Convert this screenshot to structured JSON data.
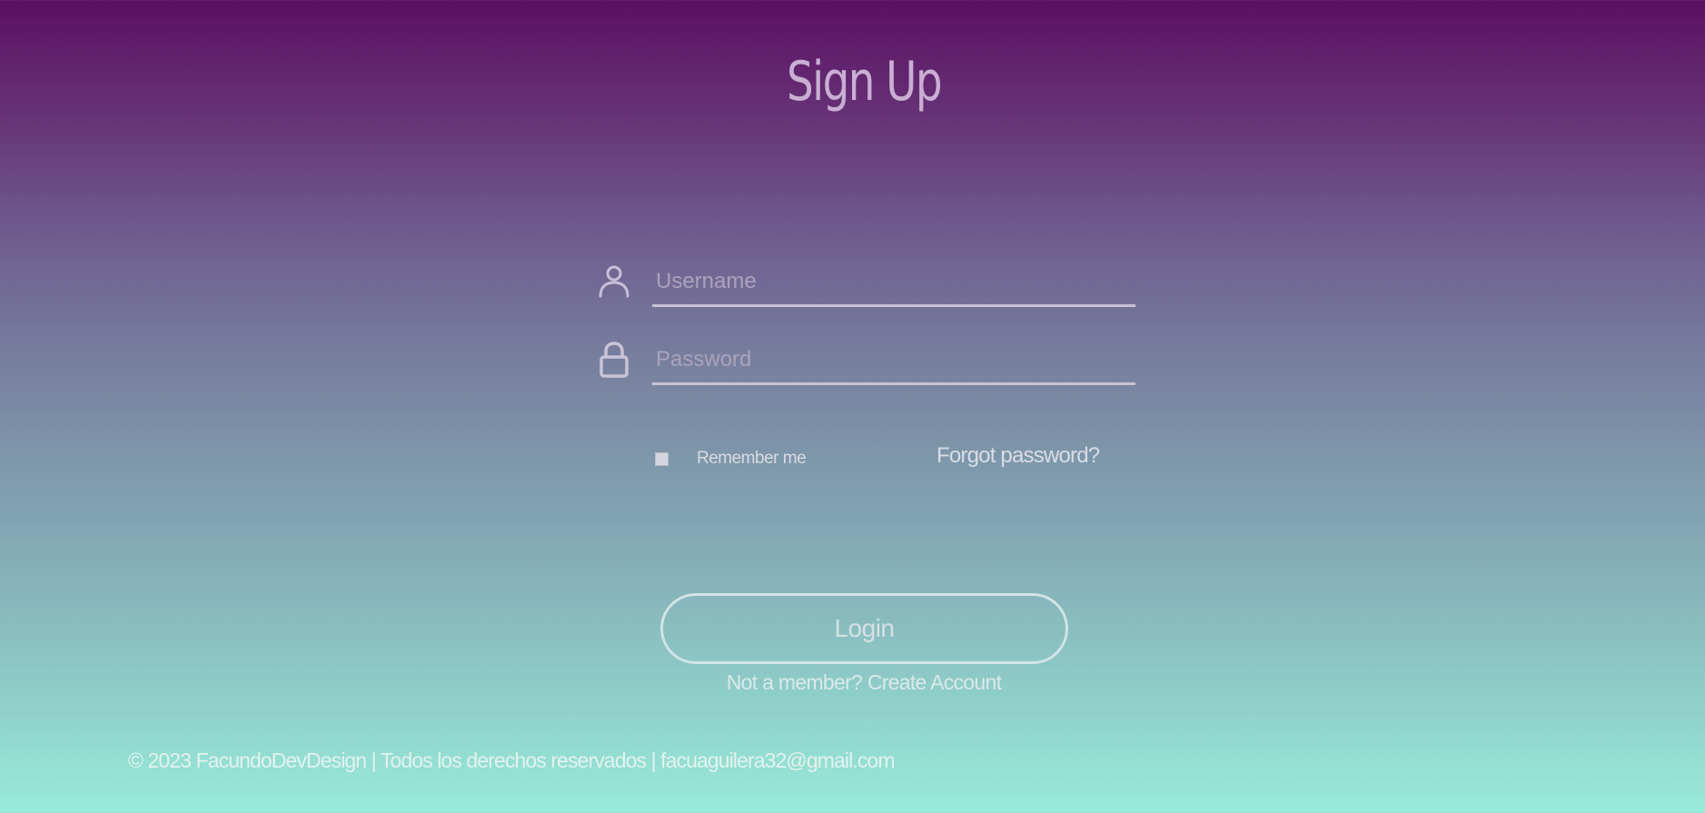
{
  "header": {
    "title": "Sign Up"
  },
  "form": {
    "username": {
      "placeholder": "Username",
      "value": ""
    },
    "password": {
      "placeholder": "Password",
      "value": ""
    },
    "remember_label": "Remember me",
    "remember_checked": false,
    "forgot_label": "Forgot password?",
    "login_label": "Login",
    "signup_hint": "Not a member? Create Account"
  },
  "footer": {
    "text": "© 2023 FacundoDevDesign | Todos los derechos reservados | facuaguilera32@gmail.com"
  },
  "icons": {
    "username": "user-icon",
    "password": "lock-icon"
  },
  "colors": {
    "gradient_top": "#5c0f62",
    "gradient_bottom": "#98ebd9",
    "input_underline": "#c7c3d6",
    "button_border": "#d2e3e6"
  }
}
